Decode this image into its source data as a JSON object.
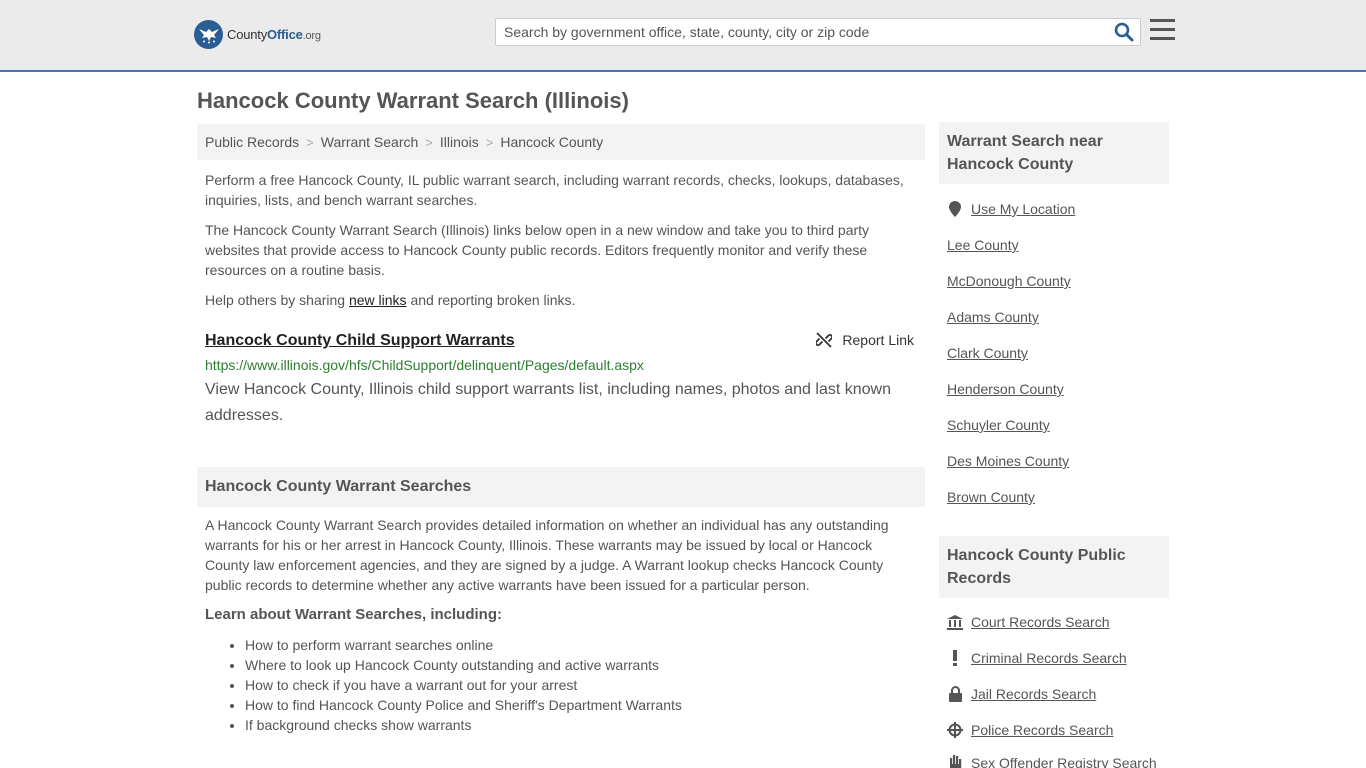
{
  "header": {
    "logo_county": "County",
    "logo_office": "Office",
    "logo_org": ".org",
    "search_placeholder": "Search by government office, state, county, city or zip code"
  },
  "page": {
    "title": "Hancock County Warrant Search (Illinois)"
  },
  "breadcrumb": [
    "Public Records",
    "Warrant Search",
    "Illinois",
    "Hancock County"
  ],
  "intro": {
    "p1": "Perform a free Hancock County, IL public warrant search, including warrant records, checks, lookups, databases, inquiries, lists, and bench warrant searches.",
    "p2": "The Hancock County Warrant Search (Illinois) links below open in a new window and take you to third party websites that provide access to Hancock County public records. Editors frequently monitor and verify these resources on a routine basis.",
    "p3_before": "Help others by sharing ",
    "p3_link": "new links",
    "p3_after": " and reporting broken links."
  },
  "link_card": {
    "title": "Hancock County Child Support Warrants",
    "report": "Report Link",
    "url": "https://www.illinois.gov/hfs/ChildSupport/delinquent/Pages/default.aspx",
    "description": "View Hancock County, Illinois child support warrants list, including names, photos and last known addresses."
  },
  "section": {
    "heading": "Hancock County Warrant Searches",
    "body": "A Hancock County Warrant Search provides detailed information on whether an individual has any outstanding warrants for his or her arrest in Hancock County, Illinois. These warrants may be issued by local or Hancock County law enforcement agencies, and they are signed by a judge. A Warrant lookup checks Hancock County public records to determine whether any active warrants have been issued for a particular person.",
    "learn_heading": "Learn about Warrant Searches, including:",
    "learn_items": [
      "How to perform warrant searches online",
      "Where to look up Hancock County outstanding and active warrants",
      "How to check if you have a warrant out for your arrest",
      "How to find Hancock County Police and Sheriff's Department Warrants",
      "If background checks show warrants"
    ]
  },
  "sidebar": {
    "nearby_heading": "Warrant Search near Hancock County",
    "use_location": "Use My Location",
    "nearby": [
      "Lee County",
      "McDonough County",
      "Adams County",
      "Clark County",
      "Henderson County",
      "Schuyler County",
      "Des Moines County",
      "Brown County"
    ],
    "records_heading": "Hancock County Public Records",
    "records": [
      {
        "label": "Court Records Search",
        "icon": "courthouse-icon"
      },
      {
        "label": "Criminal Records Search",
        "icon": "exclamation-icon"
      },
      {
        "label": "Jail Records Search",
        "icon": "lock-icon"
      },
      {
        "label": "Police Records Search",
        "icon": "crosshair-icon"
      },
      {
        "label": "Sex Offender Registry Search",
        "icon": "hand-icon"
      }
    ]
  },
  "colors": {
    "accent": "#3d77b8",
    "brand": "#2a5d94",
    "url_green": "#2e7d32"
  }
}
